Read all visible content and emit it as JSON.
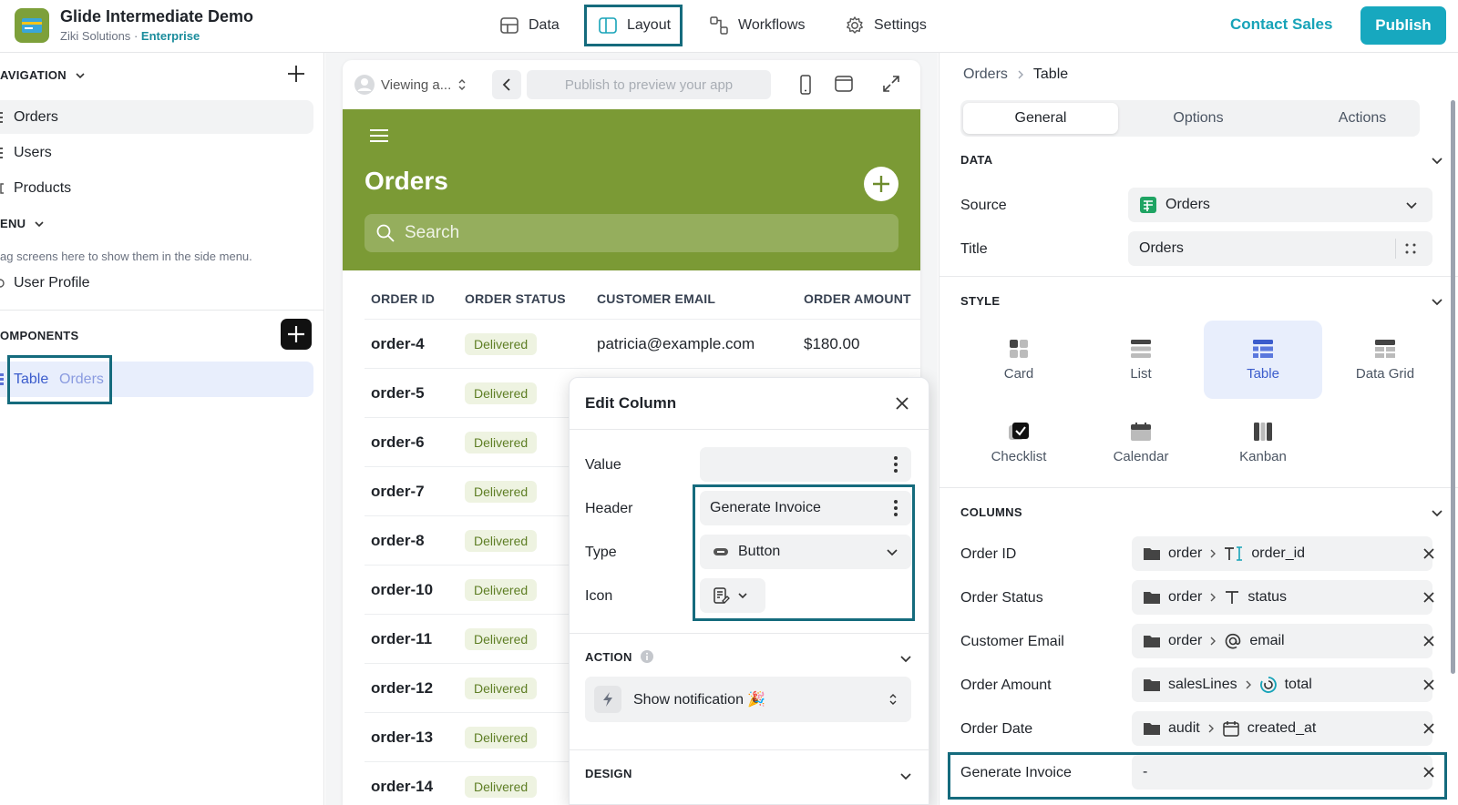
{
  "app": {
    "title": "Glide Intermediate Demo",
    "org": "Ziki Solutions",
    "plan": "Enterprise",
    "org_sep": "·"
  },
  "nav": {
    "data": "Data",
    "layout": "Layout",
    "workflows": "Workflows",
    "settings": "Settings"
  },
  "topbar": {
    "contact_sales": "Contact Sales",
    "publish": "Publish"
  },
  "sidebar": {
    "navigation_head": "AVIGATION",
    "tabs": [
      {
        "label": "Orders"
      },
      {
        "label": "Users"
      },
      {
        "label": "Products"
      }
    ],
    "menu_head": "ENU",
    "drag_hint": "ag screens here to show them in the side menu.",
    "menu_items": [
      {
        "label": "User Profile"
      }
    ],
    "components_head": "OMPONENTS",
    "component": {
      "type": "Table",
      "source": "Orders"
    }
  },
  "preview": {
    "viewing_as": "Viewing a...",
    "publish_hint": "Publish to preview your app",
    "screen_title": "Orders",
    "search_placeholder": "Search",
    "headers": [
      "ORDER ID",
      "ORDER STATUS",
      "CUSTOMER EMAIL",
      "ORDER AMOUNT"
    ],
    "rows": [
      {
        "id": "order-4",
        "status": "Delivered",
        "email": "patricia@example.com",
        "amount": "$180.00"
      },
      {
        "id": "order-5",
        "status": "Delivered"
      },
      {
        "id": "order-6",
        "status": "Delivered"
      },
      {
        "id": "order-7",
        "status": "Delivered"
      },
      {
        "id": "order-8",
        "status": "Delivered"
      },
      {
        "id": "order-10",
        "status": "Delivered"
      },
      {
        "id": "order-11",
        "status": "Delivered"
      },
      {
        "id": "order-12",
        "status": "Delivered"
      },
      {
        "id": "order-13",
        "status": "Delivered"
      },
      {
        "id": "order-14",
        "status": "Delivered"
      }
    ]
  },
  "edit_column": {
    "title": "Edit Column",
    "value_label": "Value",
    "value": "",
    "header_label": "Header",
    "header_value": "Generate Invoice",
    "type_label": "Type",
    "type_value": "Button",
    "icon_label": "Icon",
    "action_head": "ACTION",
    "action_value": "Show notification 🎉",
    "design_head": "DESIGN"
  },
  "right_panel": {
    "breadcrumb": [
      "Orders",
      "Table"
    ],
    "tabs": [
      "General",
      "Options",
      "Actions"
    ],
    "data_head": "DATA",
    "source_label": "Source",
    "source_value": "Orders",
    "title_label": "Title",
    "title_value": "Orders",
    "style_head": "STYLE",
    "styles": [
      "Card",
      "List",
      "Table",
      "Data Grid",
      "Checklist",
      "Calendar",
      "Kanban"
    ],
    "selected_style": "Table",
    "columns_head": "COLUMNS",
    "columns": [
      {
        "label": "Order ID",
        "group": "order",
        "field": "order_id",
        "icon": "text-cursor-icon"
      },
      {
        "label": "Order Status",
        "group": "order",
        "field": "status",
        "icon": "text-icon"
      },
      {
        "label": "Customer Email",
        "group": "order",
        "field": "email",
        "icon": "at-icon"
      },
      {
        "label": "Order Amount",
        "group": "salesLines",
        "field": "total",
        "icon": "rollup-icon"
      },
      {
        "label": "Order Date",
        "group": "audit",
        "field": "created_at",
        "icon": "calendar-icon"
      },
      {
        "label": "Generate Invoice",
        "value": "-"
      }
    ]
  },
  "colors": {
    "accent": "#17a8bf",
    "highlight": "#156b7d",
    "app_header": "#7b9a35",
    "selected_bg": "#e8eefc",
    "selected_text": "#3b5ccc"
  }
}
